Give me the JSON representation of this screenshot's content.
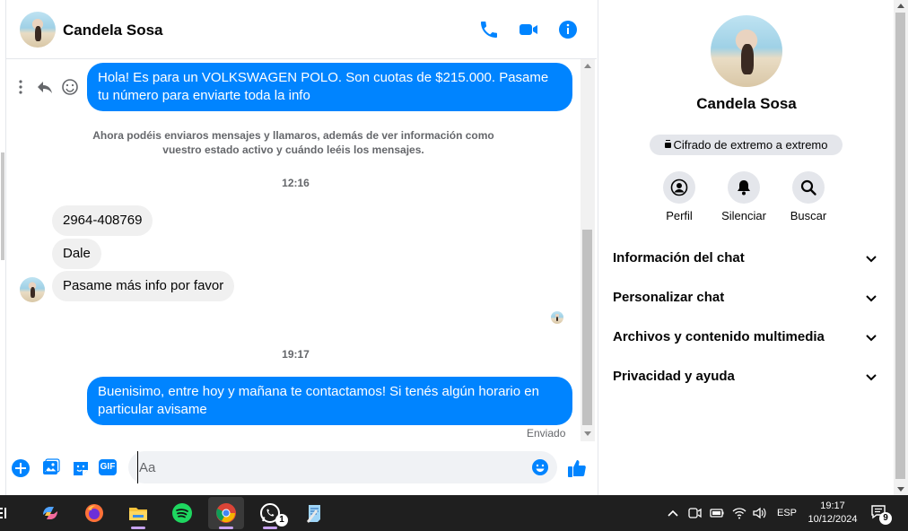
{
  "contact": {
    "name": "Candela Sosa"
  },
  "messages": {
    "out_1": "Hola! Es para un VOLKSWAGEN POLO. Son cuotas de $215.000. Pasame tu número para enviarte toda la info",
    "system_note": "Ahora podéis enviaros mensajes y llamaros, además de ver información como vuestro estado activo y cuándo leéis los mensajes.",
    "time_1": "12:16",
    "in_1": "2964-408769",
    "in_2": "Dale",
    "in_3": "Pasame más info por favor",
    "time_2": "19:17",
    "out_2": "Buenisimo, entre hoy y mañana te contactamos! Si tenés algún horario en particular avisame",
    "status": "Enviado"
  },
  "composer": {
    "placeholder": "Aa",
    "gif_label": "GIF"
  },
  "info_panel": {
    "name": "Candela Sosa",
    "encryption": "Cifrado de extremo a extremo",
    "actions": [
      {
        "label": "Perfil",
        "icon": "profile-icon"
      },
      {
        "label": "Silenciar",
        "icon": "bell-icon"
      },
      {
        "label": "Buscar",
        "icon": "search-icon"
      }
    ],
    "sections": [
      "Información del chat",
      "Personalizar chat",
      "Archivos y contenido multimedia",
      "Privacidad y ayuda"
    ]
  },
  "taskbar": {
    "lang": "ESP",
    "time": "19:17",
    "date": "10/12/2024",
    "whatsapp_badge": "1",
    "notification_badge": "9"
  },
  "colors": {
    "accent": "#0084ff",
    "incoming": "#f0f0f0"
  }
}
